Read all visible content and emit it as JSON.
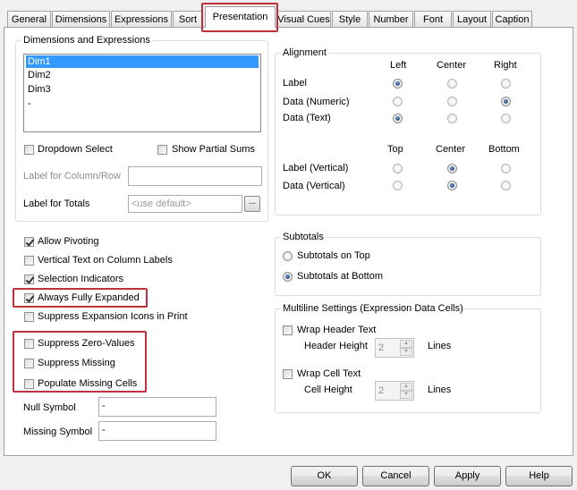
{
  "tabs": [
    {
      "label": "General"
    },
    {
      "label": "Dimensions"
    },
    {
      "label": "Expressions"
    },
    {
      "label": "Sort"
    },
    {
      "label": "Presentation"
    },
    {
      "label": "Visual Cues"
    },
    {
      "label": "Style"
    },
    {
      "label": "Number"
    },
    {
      "label": "Font"
    },
    {
      "label": "Layout"
    },
    {
      "label": "Caption"
    }
  ],
  "dimensions_group": {
    "title": "Dimensions and Expressions",
    "items": [
      "Dim1",
      "Dim2",
      "Dim3",
      "-"
    ],
    "dropdown_select": "Dropdown Select",
    "show_partial_sums": "Show Partial Sums",
    "label_for_column_row": "Label for Column/Row",
    "label_for_totals": "Label for Totals",
    "totals_placeholder": "<use default>",
    "browse_button": "..."
  },
  "alignment": {
    "title": "Alignment",
    "col_left": "Left",
    "col_center": "Center",
    "col_right": "Right",
    "row_label": "Label",
    "row_data_numeric": "Data (Numeric)",
    "row_data_text": "Data (Text)",
    "col_top": "Top",
    "col_center_v": "Center",
    "col_bottom": "Bottom",
    "row_label_vertical": "Label (Vertical)",
    "row_data_vertical": "Data (Vertical)"
  },
  "options": {
    "allow_pivoting": "Allow Pivoting",
    "vertical_text": "Vertical Text on Column Labels",
    "selection_indicators": "Selection Indicators",
    "always_fully_expanded": "Always Fully Expanded",
    "suppress_expansion_icons": "Suppress Expansion Icons in Print",
    "suppress_zero_values": "Suppress Zero-Values",
    "suppress_missing": "Suppress Missing",
    "populate_missing_cells": "Populate Missing Cells",
    "null_symbol_label": "Null Symbol",
    "null_symbol_value": "-",
    "missing_symbol_label": "Missing Symbol",
    "missing_symbol_value": "-"
  },
  "subtotals": {
    "title": "Subtotals",
    "on_top": "Subtotals on Top",
    "at_bottom": "Subtotals at Bottom"
  },
  "multiline": {
    "title": "Multiline Settings (Expression Data Cells)",
    "wrap_header_text": "Wrap Header Text",
    "header_height_label": "Header Height",
    "header_height_value": "2",
    "wrap_cell_text": "Wrap Cell Text",
    "cell_height_label": "Cell Height",
    "cell_height_value": "2",
    "lines": "Lines"
  },
  "buttons": {
    "ok": "OK",
    "cancel": "Cancel",
    "apply": "Apply",
    "help": "Help"
  },
  "colors": {
    "highlight_box": "#c0303a",
    "selection": "#3399ff"
  }
}
